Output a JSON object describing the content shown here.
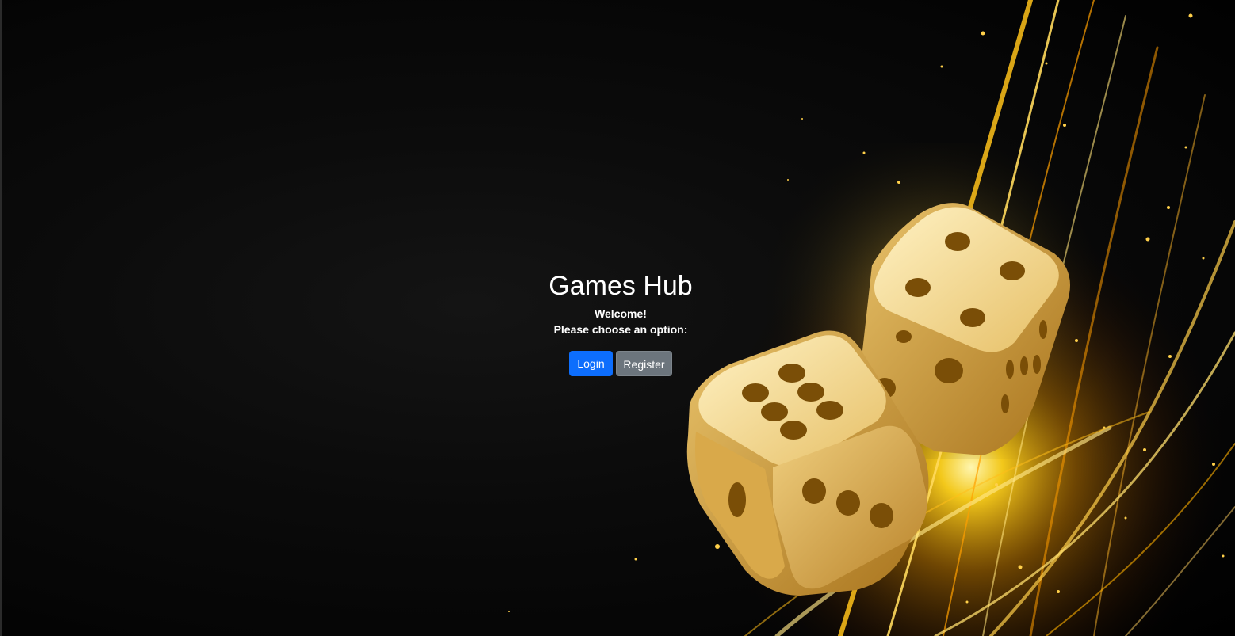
{
  "header": {
    "title": "Games Hub",
    "welcome": "Welcome!",
    "prompt": "Please choose an option:"
  },
  "actions": {
    "login_label": "Login",
    "register_label": "Register"
  },
  "colors": {
    "login": "#0d6efd",
    "register": "#6c757d",
    "accent_gold": "#f5c542"
  },
  "background": {
    "icon": "golden-dice-illustration"
  }
}
